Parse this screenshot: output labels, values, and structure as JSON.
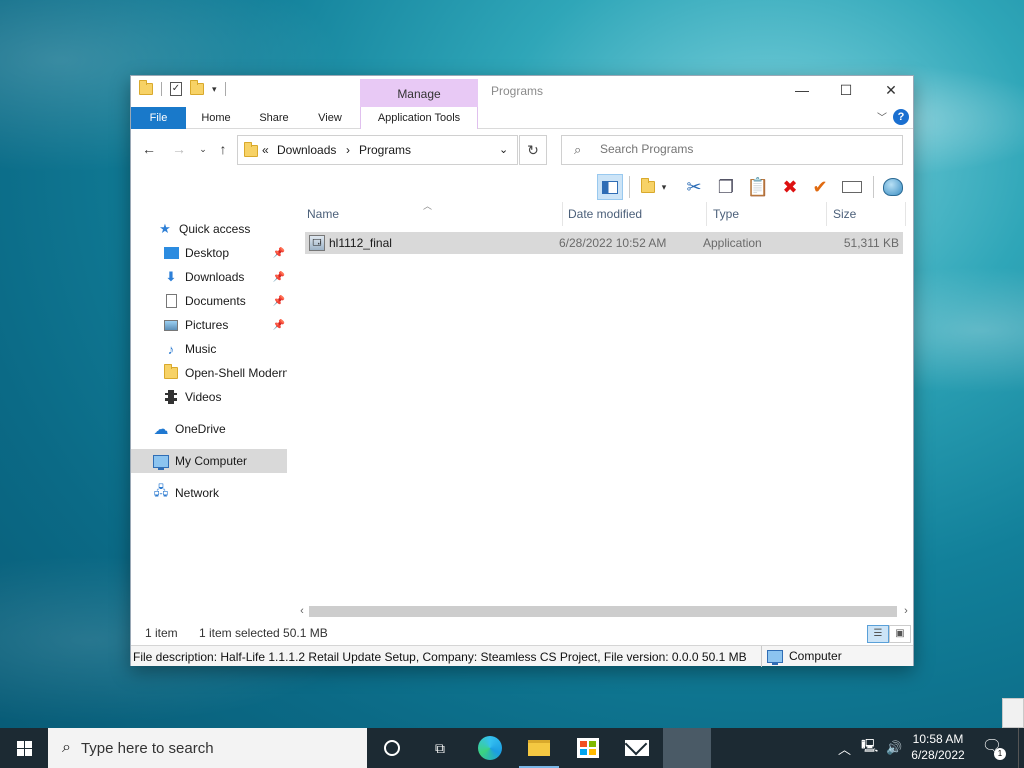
{
  "window": {
    "title": "Programs",
    "manage_tab": "Manage",
    "controls": {
      "minimize": "—",
      "maximize": "☐",
      "close": "✕"
    }
  },
  "ribbon": {
    "tabs": [
      {
        "label": "File"
      },
      {
        "label": "Home"
      },
      {
        "label": "Share"
      },
      {
        "label": "View"
      },
      {
        "label": "Application Tools"
      }
    ],
    "help": "?"
  },
  "address": {
    "prefix": "«",
    "crumbs": [
      "Downloads",
      "Programs"
    ],
    "separator": "›"
  },
  "search": {
    "placeholder": "Search Programs"
  },
  "toolbar": {
    "icons": [
      "layout-pane-icon",
      "folder-options-icon",
      "cut-icon",
      "copy-icon",
      "paste-icon",
      "delete-icon",
      "properties-check-icon",
      "rename-icon",
      "shell-icon"
    ]
  },
  "nav": {
    "items": [
      {
        "label": "Quick access",
        "icon": "star-icon"
      },
      {
        "label": "Desktop",
        "icon": "desktop-icon",
        "pinned": true
      },
      {
        "label": "Downloads",
        "icon": "download-icon",
        "pinned": true
      },
      {
        "label": "Documents",
        "icon": "document-icon",
        "pinned": true
      },
      {
        "label": "Pictures",
        "icon": "pictures-icon",
        "pinned": true
      },
      {
        "label": "Music",
        "icon": "music-icon"
      },
      {
        "label": "Open-Shell Modern",
        "icon": "folder-icon"
      },
      {
        "label": "Videos",
        "icon": "video-icon"
      },
      {
        "label": "OneDrive",
        "icon": "cloud-icon"
      },
      {
        "label": "My Computer",
        "icon": "computer-icon"
      },
      {
        "label": "Network",
        "icon": "network-icon"
      }
    ]
  },
  "columns": {
    "name": "Name",
    "date": "Date modified",
    "type": "Type",
    "size": "Size"
  },
  "files": [
    {
      "name": "hl1112_final",
      "date": "6/28/2022 10:52 AM",
      "type": "Application",
      "size": "51,311 KB"
    }
  ],
  "status": {
    "count": "1 item",
    "selected": "1 item selected  50.1 MB"
  },
  "infobar": {
    "description": "File description: Half-Life 1.1.1.2 Retail Update Setup, Company: Steamless CS Project, File version: 0.0.0  50.1 MB",
    "zone": "Computer"
  },
  "taskbar": {
    "search_placeholder": "Type here to search",
    "time": "10:58 AM",
    "date": "6/28/2022",
    "notifications": "1"
  }
}
